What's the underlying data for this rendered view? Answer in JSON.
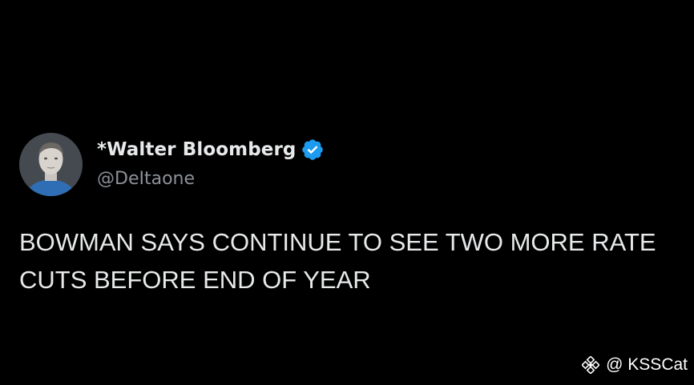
{
  "tweet": {
    "author": {
      "display_name": "*Walter Bloomberg",
      "handle": "@DeItaone",
      "verified": true,
      "avatar_icon": "profile-photo"
    },
    "text_lines": [
      "BOWMAN SAYS CONTINUE TO SEE TWO MORE RATE",
      "CUTS BEFORE END OF YEAR"
    ]
  },
  "watermark": {
    "text": "@ KSSCat",
    "logo_icon": "binance-logo-icon"
  },
  "colors": {
    "background": "#000000",
    "text_primary": "#e7e9ea",
    "text_secondary": "#8b9196",
    "verified_blue": "#1d9bf0"
  }
}
